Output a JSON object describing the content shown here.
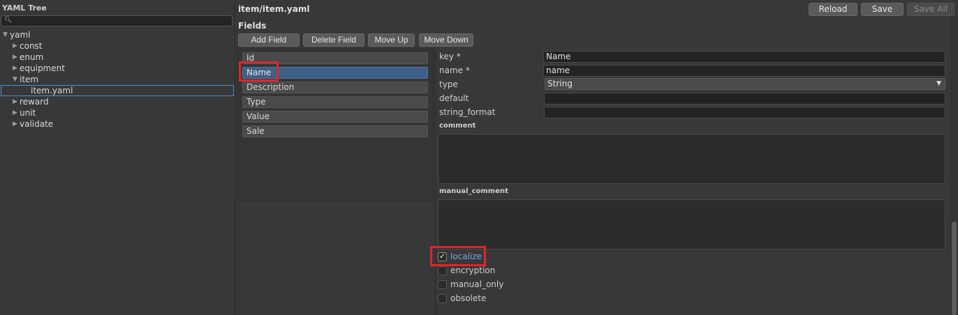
{
  "tree_panel": {
    "title": "YAML Tree",
    "search": {
      "value": "",
      "placeholder": ""
    },
    "items": [
      {
        "label": "yaml",
        "level": 0,
        "expanded": true,
        "has_children": true
      },
      {
        "label": "const",
        "level": 1,
        "expanded": false,
        "has_children": true
      },
      {
        "label": "enum",
        "level": 1,
        "expanded": false,
        "has_children": true
      },
      {
        "label": "equipment",
        "level": 1,
        "expanded": false,
        "has_children": true
      },
      {
        "label": "item",
        "level": 1,
        "expanded": true,
        "has_children": true
      },
      {
        "label": "item.yaml",
        "level": 2,
        "has_children": false,
        "selected": true
      },
      {
        "label": "reward",
        "level": 1,
        "expanded": false,
        "has_children": true
      },
      {
        "label": "unit",
        "level": 1,
        "expanded": false,
        "has_children": true
      },
      {
        "label": "validate",
        "level": 1,
        "expanded": false,
        "has_children": true
      }
    ]
  },
  "header": {
    "title": "item/item.yaml",
    "reload_label": "Reload",
    "save_label": "Save",
    "save_all_label": "Save All"
  },
  "fields": {
    "label": "Fields",
    "toolbar": {
      "add_label": "Add Field",
      "delete_label": "Delete Field",
      "move_up_label": "Move Up",
      "move_down_label": "Move Down"
    },
    "items": [
      "Id",
      "Name",
      "Description",
      "Type",
      "Value",
      "Sale"
    ],
    "selected_index": 1
  },
  "details": {
    "key_label": "key *",
    "key_value": "Name",
    "name_label": "name *",
    "name_value": "name",
    "type_label": "type",
    "type_value": "String",
    "default_label": "default",
    "default_value": "",
    "string_format_label": "string_format",
    "string_format_value": "",
    "comment_label": "comment",
    "comment_value": "",
    "manual_comment_label": "manual_comment",
    "manual_comment_value": "",
    "checks": [
      {
        "label": "localize",
        "checked": true
      },
      {
        "label": "encryption",
        "checked": false
      },
      {
        "label": "manual_only",
        "checked": false
      },
      {
        "label": "obsolete",
        "checked": false
      }
    ]
  },
  "colors": {
    "background": "#383838",
    "selection": "#3f5f86",
    "highlight": "#e0242a",
    "accent_text": "#7aa6e0"
  },
  "icons": {
    "search": "search-icon",
    "expanded": "triangle-down-icon",
    "collapsed": "triangle-right-icon",
    "dropdown": "chevron-down-icon",
    "check": "checkmark-icon"
  }
}
